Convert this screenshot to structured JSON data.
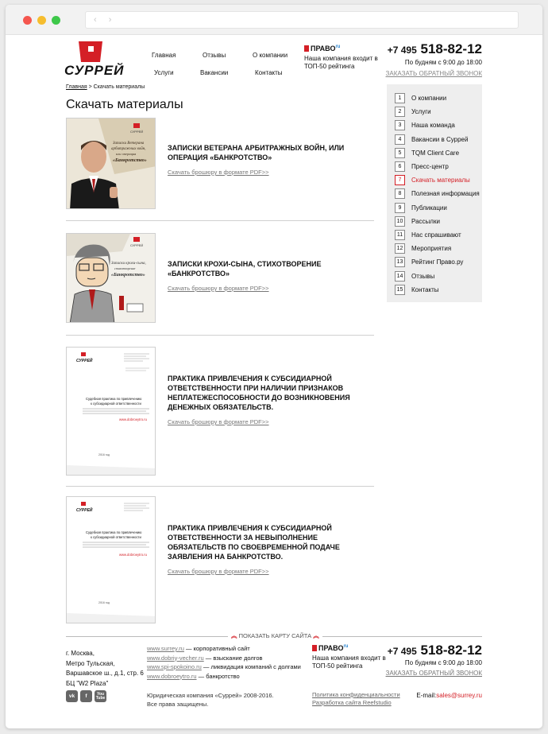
{
  "header": {
    "logo_text": "СУРРЕЙ",
    "nav": [
      "Главная",
      "Отзывы",
      "О компании",
      "Услуги",
      "Вакансии",
      "Контакты"
    ],
    "pravo_logo": "ПРАВО",
    "pravo_tag": "ru",
    "pravo_text": "Наша компания входит в ТОП-50 рейтинга",
    "phone_prefix": "+7 495",
    "phone_number": "518-82-12",
    "hours": "По будням с 9:00 до 18:00",
    "callback": "Заказать обратный звонок"
  },
  "breadcrumb": {
    "home": "Главная",
    "separator": " > ",
    "current": "Скачать материалы"
  },
  "page_title": "Скачать материалы",
  "items": [
    {
      "title": "Записки ветерана арбитражных войн, или операция «Банкротство»",
      "link": "Скачать брошюру в формате PDF>>",
      "cover_text": "Записки Ветерана арбитражных войн, или операция «Банкротство»"
    },
    {
      "title": "Записки крохи-сына, стихотворение «Банкротство»",
      "link": "Скачать брошюру в формате PDF>>",
      "cover_text": "Записки крохи-сына, стихотворение «Банкротство»"
    },
    {
      "title": "Практика привлечения к субсидиарной ответственности при наличии признаков неплатежеспособности до возникновения денежных обязательств.",
      "link": "Скачать брошюру в формате PDF>>",
      "cover_text": "Судебная практика по привлечению к субсидиарной ответственности",
      "cover_url": "www.dobroeytro.ru",
      "cover_year": "2016 год"
    },
    {
      "title": "Практика привлечения к субсидиарной ответственности за невыполнение обязательств по своевременной подаче заявления на банкротство.",
      "link": "Скачать брошюру в формате PDF>>",
      "cover_text": "Судебная практика по привлечению к субсидиарной ответственности",
      "cover_url": "www.dobroeytro.ru",
      "cover_year": "2016 год"
    }
  ],
  "sidebar": [
    {
      "num": "1",
      "label": "О компании"
    },
    {
      "num": "2",
      "label": "Услуги"
    },
    {
      "num": "3",
      "label": "Наша команда"
    },
    {
      "num": "4",
      "label": "Вакансии в Суррей"
    },
    {
      "num": "5",
      "label": "TQM Client Care"
    },
    {
      "num": "6",
      "label": "Пресс-центр"
    },
    {
      "num": "7",
      "label": "Скачать материалы"
    },
    {
      "num": "8",
      "label": "Полезная информация"
    },
    {
      "num": "9",
      "label": "Публикации"
    },
    {
      "num": "10",
      "label": "Рассылки"
    },
    {
      "num": "11",
      "label": "Нас спрашивают"
    },
    {
      "num": "12",
      "label": "Мероприятия"
    },
    {
      "num": "13",
      "label": "Рейтинг Право.ру"
    },
    {
      "num": "14",
      "label": "Отзывы"
    },
    {
      "num": "15",
      "label": "Контакты"
    }
  ],
  "footer": {
    "sitemap": "Показать карту сайта",
    "address": [
      "г. Москва,",
      "Метро Тульская,",
      "Варшавское ш., д.1, стр. 6",
      "БЦ \"W2 Plaza\""
    ],
    "social": [
      "vk",
      "f",
      "You Tube"
    ],
    "links": [
      {
        "url": "www.surrey.ru",
        "desc": " — корпоративный сайт"
      },
      {
        "url": "www.dobriy-vecher.ru",
        "desc": " — взыскание долгов"
      },
      {
        "url": "www.spi-spokoino.ru",
        "desc": " — ликвидация компаний с долгами"
      },
      {
        "url": "www.dobroeytro.ru",
        "desc": " — банкротство"
      }
    ],
    "copyright": "Юридическая компания «Суррей» 2008-2016.",
    "rights": "Все права защищены.",
    "policy": "Политика конфиденциальности",
    "dev": "Разработка сайта Reefstudio",
    "email_label": "E-mail:",
    "email": "sales@surrey.ru"
  },
  "colors": {
    "accent": "#d41f26",
    "sidebar_bg": "#eeeeee",
    "link_gray": "#777777"
  }
}
